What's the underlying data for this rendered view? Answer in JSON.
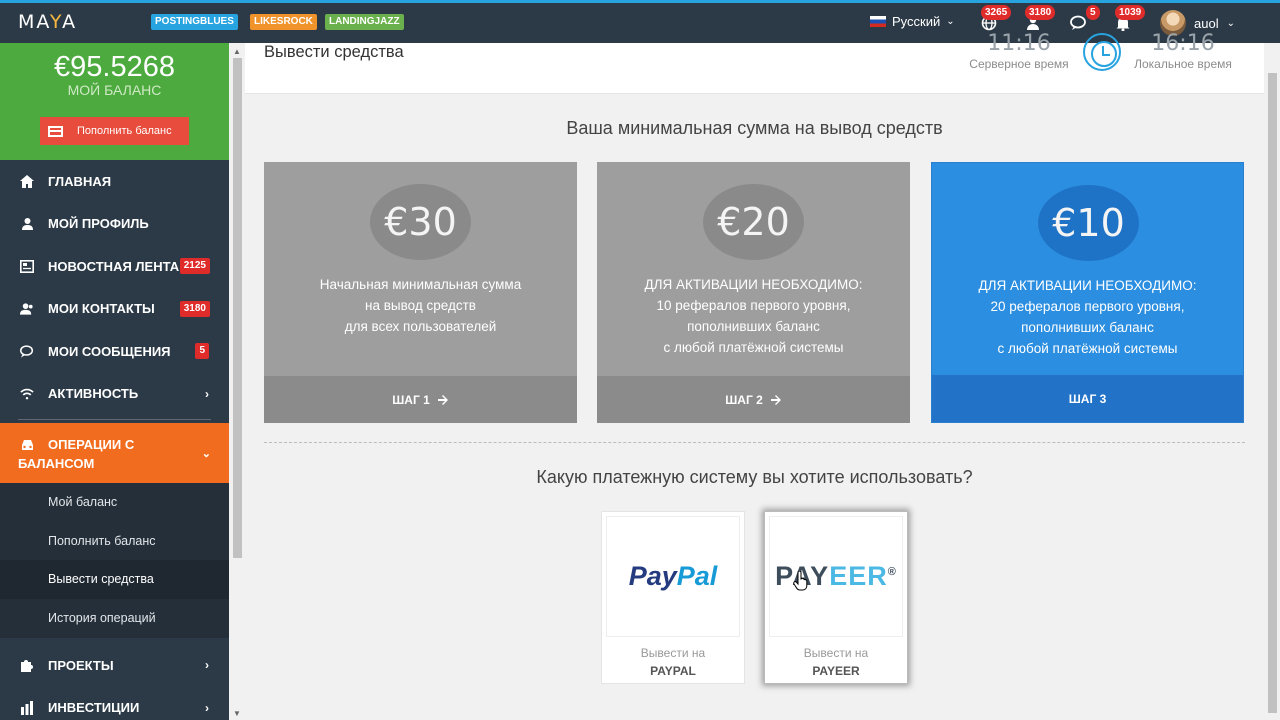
{
  "topbar": {
    "logo_left": "MA",
    "logo_y": "Y",
    "logo_right": "A",
    "tags": [
      {
        "label": "POSTINGBLUES",
        "color": "#27a3e0"
      },
      {
        "label": "LIKESROCK",
        "color": "#f0932b"
      },
      {
        "label": "LANDINGJAZZ",
        "color": "#6ab04c"
      }
    ],
    "language": "Русский",
    "badges": {
      "globe": "3265",
      "contacts": "3180",
      "messages": "5",
      "notifications": "1039"
    },
    "username": "auol"
  },
  "sidebar": {
    "balance_amount": "€95.5268",
    "balance_label": "МОЙ БАЛАНС",
    "topup_label": "Пополнить баланс",
    "items": [
      {
        "label": "ГЛАВНАЯ",
        "icon": "home-icon"
      },
      {
        "label": "МОЙ ПРОФИЛЬ",
        "icon": "user-icon"
      },
      {
        "label": "НОВОСТНАЯ ЛЕНТА",
        "icon": "news-icon",
        "badge": "2125"
      },
      {
        "label": "МОИ КОНТАКТЫ",
        "icon": "contacts-icon",
        "badge": "3180"
      },
      {
        "label": "МОИ СООБЩЕНИЯ",
        "icon": "chat-icon",
        "badge": "5"
      },
      {
        "label": "АКТИВНОСТЬ",
        "icon": "wifi-icon"
      }
    ],
    "active_line1": "ОПЕРАЦИИ С",
    "active_line2": "БАЛАНСОМ",
    "sub_items": [
      "Мой баланс",
      "Пополнить баланс",
      "Вывести средства",
      "История операций"
    ],
    "bottom_items": [
      {
        "label": "ПРОЕКТЫ",
        "icon": "puzzle-icon"
      },
      {
        "label": "ИНВЕСТИЦИИ",
        "icon": "invest-icon"
      }
    ]
  },
  "page": {
    "title": "Вывести средства",
    "server_time": "11:16",
    "server_time_label": "Серверное время",
    "local_time": "16:16",
    "local_time_label": "Локальное время"
  },
  "min_section": {
    "heading": "Ваша минимальная сумма на вывод средств",
    "cards": [
      {
        "amount": "€30",
        "lines": [
          "Начальная минимальная сумма",
          "на вывод средств",
          "для всех пользователей"
        ],
        "step": "ШАГ 1"
      },
      {
        "amount": "€20",
        "lines": [
          "ДЛЯ АКТИВАЦИИ НЕОБХОДИМО:",
          "10 рефералов первого уровня,",
          "пополнивших баланс",
          "с любой платёжной системы"
        ],
        "step": "ШАГ 2"
      },
      {
        "amount": "€10",
        "lines": [
          "ДЛЯ АКТИВАЦИИ НЕОБХОДИМО:",
          "20 рефералов первого уровня,",
          "пополнивших баланс",
          "с любой платёжной системы"
        ],
        "step": "ШАГ 3"
      }
    ]
  },
  "payment": {
    "heading": "Какую платежную систему вы хотите использовать?",
    "options": [
      {
        "logo_a": "Pay",
        "logo_b": "Pal",
        "caption": "Вывести на",
        "name": "PAYPAL"
      },
      {
        "logo_a": "PAY",
        "logo_b": "EER",
        "logo_mark": "®",
        "caption": "Вывести на",
        "name": "PAYEER"
      }
    ]
  }
}
